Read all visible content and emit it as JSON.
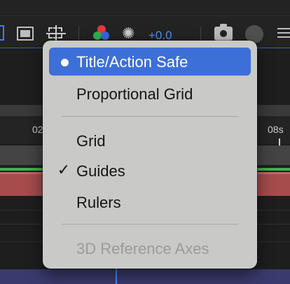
{
  "toolbar": {
    "exposure_value": "+0.0",
    "icons": [
      "grid-toggle-icon",
      "safe-margins-icon",
      "grid-guides-icon",
      "rgb-channels-icon",
      "aperture-icon",
      "camera-icon",
      "fx-icon",
      "panel-menu-icon"
    ],
    "accent_color": "#4f8ff7"
  },
  "timeline": {
    "ruler_labels": [
      "02",
      "08s"
    ],
    "layer_colors": {
      "track": "#444444",
      "work_area": "#3fb548",
      "layer": "#a64c4c",
      "lower_layer": "#3a3a6e"
    }
  },
  "menu": {
    "items": [
      {
        "label": "Title/Action Safe",
        "state": "selected",
        "marker": "dot"
      },
      {
        "label": "Proportional Grid",
        "state": "normal",
        "marker": ""
      },
      {
        "label": "Grid",
        "state": "normal",
        "marker": ""
      },
      {
        "label": "Guides",
        "state": "normal",
        "marker": "✓"
      },
      {
        "label": "Rulers",
        "state": "normal",
        "marker": ""
      },
      {
        "label": "3D Reference Axes",
        "state": "disabled",
        "marker": ""
      }
    ],
    "selection_color": "#3d6fd8",
    "background_color": "#c9c9c7"
  }
}
